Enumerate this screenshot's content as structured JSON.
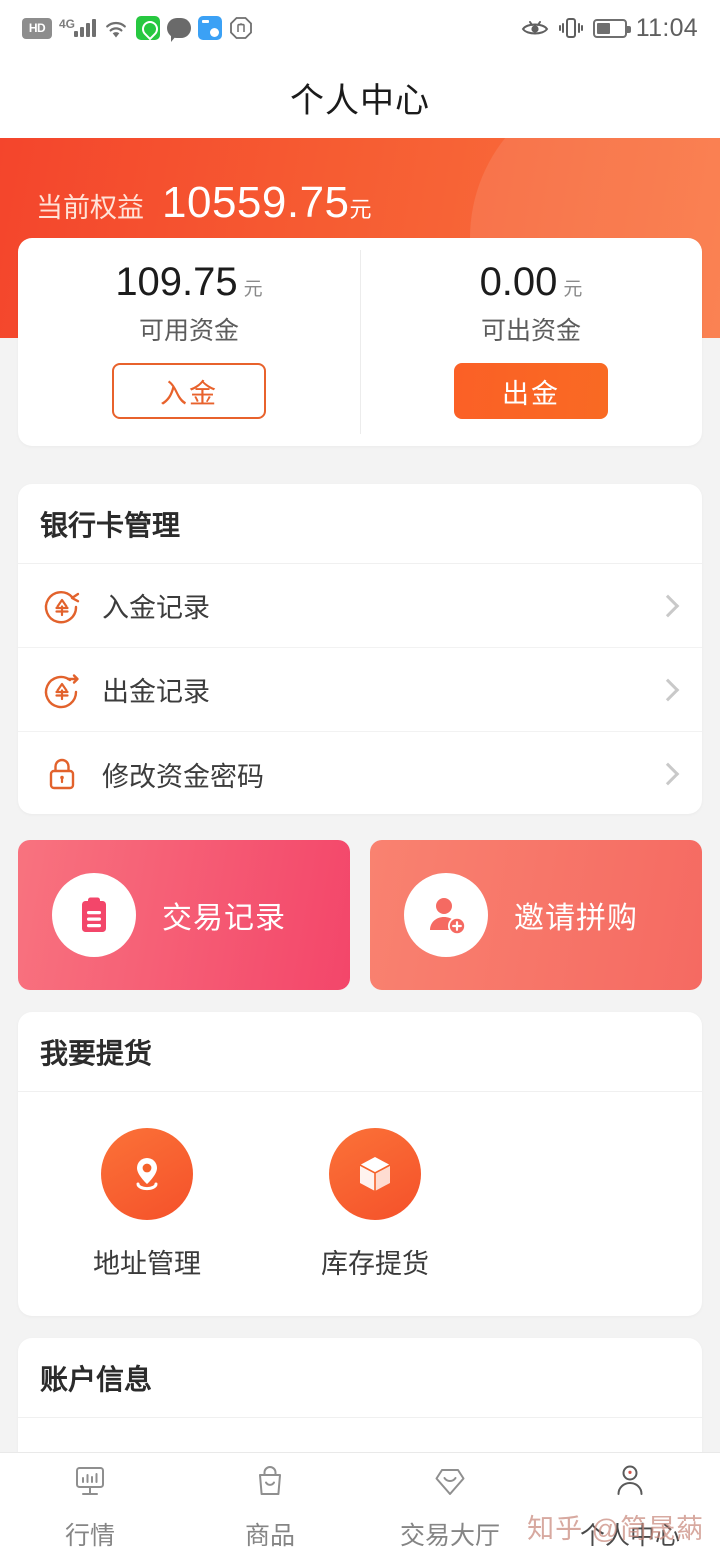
{
  "status_bar": {
    "network_badge": "HD",
    "signal_gen": "4G",
    "time": "11:04",
    "icons": [
      "hd-badge-icon",
      "signal-bars-icon",
      "wifi-icon",
      "green-location-app-icon",
      "chat-bubble-icon",
      "blue-app-icon",
      "hand-stop-icon",
      "eye-care-icon",
      "vibrate-icon",
      "battery-icon"
    ]
  },
  "header": {
    "title": "个人中心"
  },
  "hero": {
    "label": "当前权益",
    "amount": "10559.75",
    "unit": "元"
  },
  "funds": [
    {
      "amount": "109.75",
      "unit": "元",
      "label": "可用资金",
      "button": "入金",
      "style": "outline"
    },
    {
      "amount": "0.00",
      "unit": "元",
      "label": "可出资金",
      "button": "出金",
      "style": "solid"
    }
  ],
  "bank_section": {
    "title": "银行卡管理",
    "rows": [
      {
        "label": "入金记录",
        "icon": "yen-deposit-icon"
      },
      {
        "label": "出金记录",
        "icon": "yen-withdraw-icon"
      },
      {
        "label": "修改资金密码",
        "icon": "lock-icon"
      }
    ]
  },
  "promos": [
    {
      "label": "交易记录",
      "icon": "clipboard-icon"
    },
    {
      "label": "邀请拼购",
      "icon": "user-add-icon"
    }
  ],
  "pickup_section": {
    "title": "我要提货",
    "items": [
      {
        "label": "地址管理",
        "icon": "map-pin-icon"
      },
      {
        "label": "库存提货",
        "icon": "box-icon"
      }
    ]
  },
  "account_section": {
    "title": "账户信息"
  },
  "tabbar": [
    {
      "label": "行情",
      "icon": "monitor-chart-icon",
      "active": false
    },
    {
      "label": "商品",
      "icon": "shopping-bag-icon",
      "active": false
    },
    {
      "label": "交易大厅",
      "icon": "diamond-icon",
      "active": false
    },
    {
      "label": "个人中心",
      "icon": "person-icon",
      "active": true
    }
  ],
  "watermark": "知乎 @简晟蒳",
  "colors": {
    "hero_start": "#f4452c",
    "hero_end": "#fa7440",
    "accent_orange": "#f5622a",
    "promo_a": "#f3466a",
    "promo_b": "#f56a62",
    "text_dark": "#1c1c1c",
    "text_muted": "#8a8a8a"
  }
}
